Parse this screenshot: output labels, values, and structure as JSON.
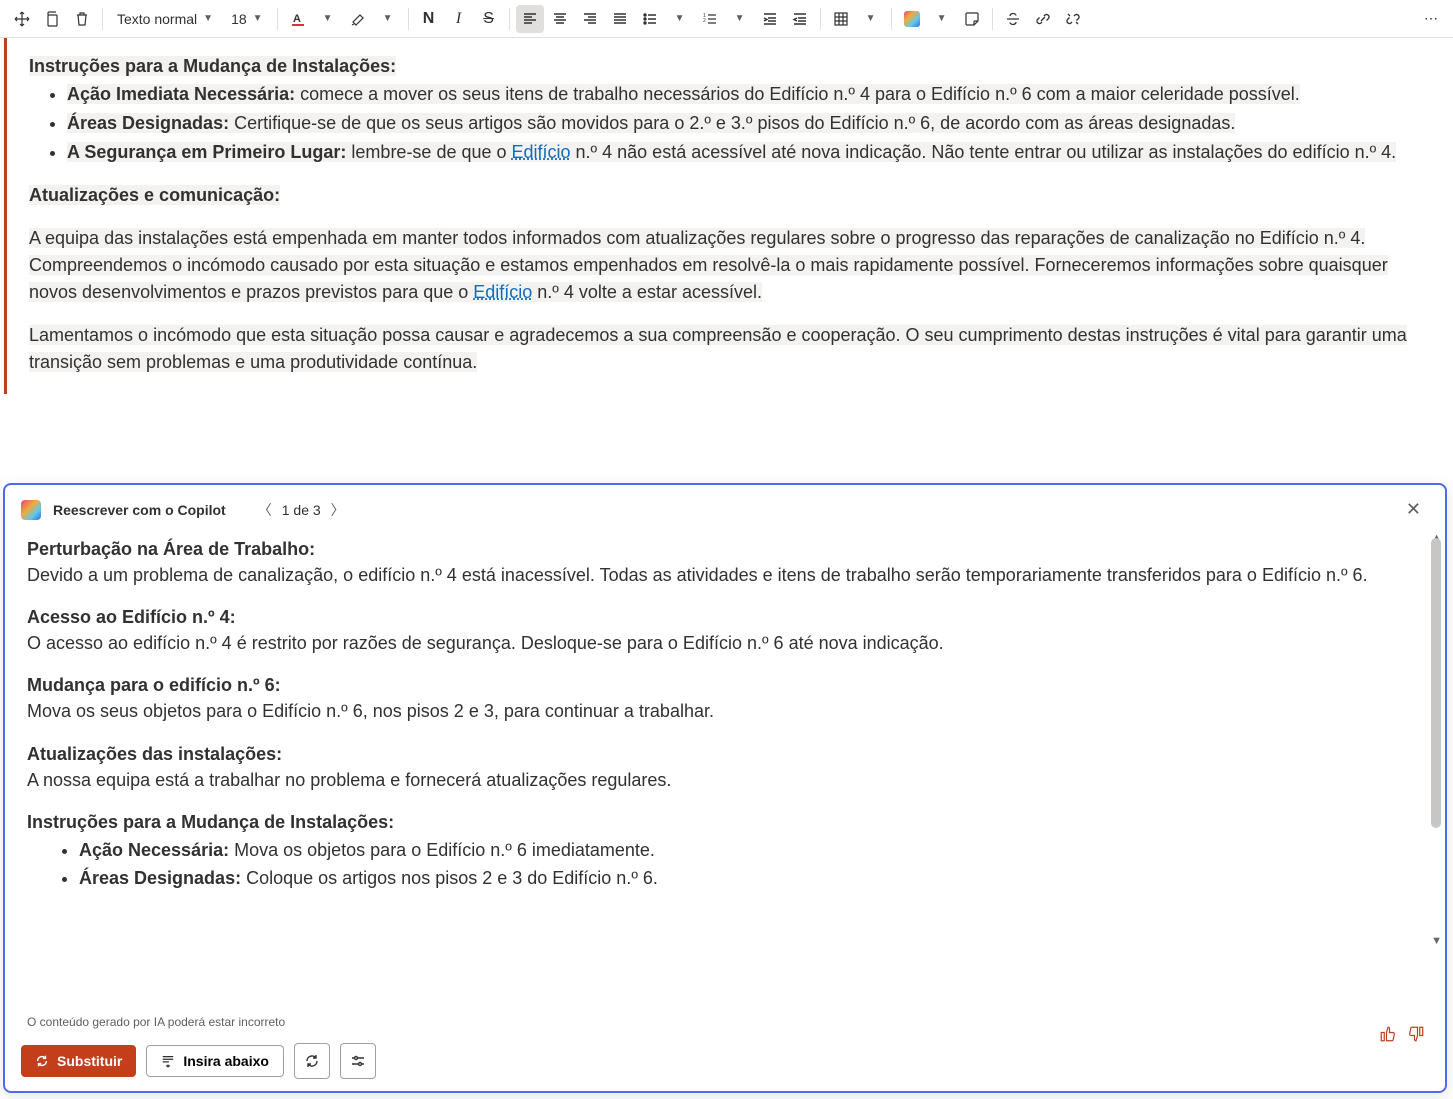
{
  "toolbar": {
    "style_label": "Texto normal",
    "font_size": "18",
    "bold": "N",
    "italic": "I",
    "strike": "S"
  },
  "document": {
    "heading1": "Instruções para a Mudança de Instalações:",
    "bullet1_label": "Ação Imediata Necessária:",
    "bullet1_text": " comece a mover os seus itens de trabalho necessários do Edifício n.º 4 para o Edifício n.º 6 com a maior celeridade possível.",
    "bullet2_label": "Áreas Designadas:",
    "bullet2_text": " Certifique-se de que os seus artigos são movidos para o 2.º e 3.º pisos do Edifício n.º 6, de acordo com as áreas designadas.",
    "bullet3_label": "A Segurança em Primeiro Lugar:",
    "bullet3_text_a": " lembre-se de que o ",
    "bullet3_link": "Edifício",
    "bullet3_text_b": " n.º 4 não está acessível até nova indicação. Não tente entrar ou utilizar as instalações do edifício n.º 4.",
    "heading2": "Atualizações e comunicação:",
    "para1_a": "A equipa das instalações está empenhada em manter todos informados com atualizações regulares sobre o progresso das reparações de canalização no Edifício n.º 4. Compreendemos o incómodo causado por esta situação e estamos empenhados em resolvê-la o mais rapidamente possível. Forneceremos informações sobre quaisquer novos desenvolvimentos e prazos previstos para que o ",
    "para1_link": "Edifício",
    "para1_b": " n.º 4 volte a estar acessível.",
    "para2": "Lamentamos o incómodo que esta situação possa causar e agradecemos a sua compreensão e cooperação. O seu cumprimento destas instruções é vital para garantir uma transição sem problemas e uma produtividade contínua."
  },
  "copilot": {
    "title": "Reescrever com o Copilot",
    "pager": "1 de 3",
    "s1_h": "Perturbação na Área de Trabalho:",
    "s1_p": "Devido a um problema de canalização, o edifício n.º 4 está inacessível. Todas as atividades e itens de trabalho serão temporariamente transferidos para o Edifício n.º 6.",
    "s2_h": "Acesso ao Edifício n.º 4:",
    "s2_p": "O acesso ao edifício n.º 4 é restrito por razões de segurança. Desloque-se para o Edifício n.º 6 até nova indicação.",
    "s3_h": "Mudança para o edifício n.º 6:",
    "s3_p": "Mova os seus objetos para o Edifício n.º 6, nos pisos 2 e 3, para continuar a trabalhar.",
    "s4_h": "Atualizações das instalações:",
    "s4_p": "A nossa equipa está a trabalhar no problema e fornecerá atualizações regulares.",
    "s5_h": "Instruções para a Mudança de Instalações:",
    "s5_b1_l": "Ação Necessária:",
    "s5_b1_t": " Mova os objetos para o Edifício n.º 6 imediatamente.",
    "s5_b2_l": "Áreas Designadas:",
    "s5_b2_t": " Coloque os artigos nos pisos 2 e 3 do Edifício n.º 6.",
    "disclaimer": "O conteúdo gerado por IA poderá estar incorreto",
    "btn_replace": "Substituir",
    "btn_insert": "Insira abaixo"
  }
}
